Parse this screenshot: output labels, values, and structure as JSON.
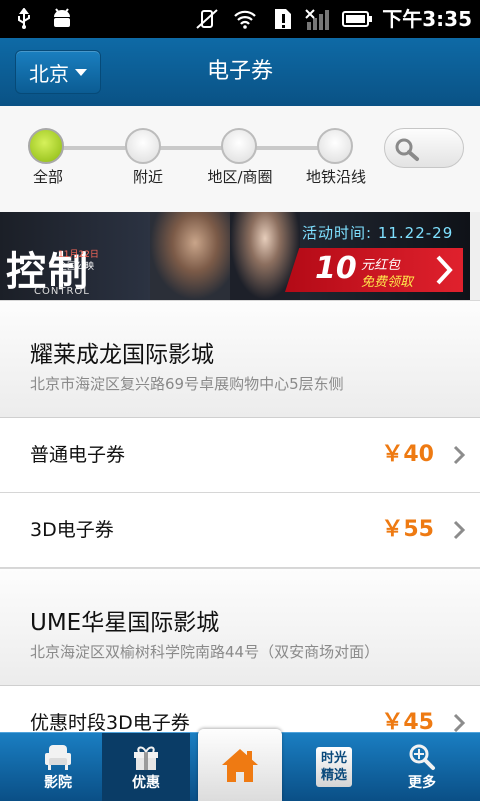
{
  "status_bar": {
    "time": "下午3:35"
  },
  "header": {
    "city": "北京",
    "title": "电子券"
  },
  "filters": [
    {
      "label": "全部",
      "active": true
    },
    {
      "label": "附近",
      "active": false
    },
    {
      "label": "地区/商圈",
      "active": false
    },
    {
      "label": "地铁沿线",
      "active": false
    }
  ],
  "banner": {
    "title": "控制",
    "release_date": "11月22日",
    "release_note": "全国公映",
    "english_title": "CONTROL",
    "activity_time": "活动时间: 11.22-29",
    "coupon_amount": "10",
    "coupon_line1": "元红包",
    "coupon_line2": "免费领取"
  },
  "cinemas": [
    {
      "name": "耀莱成龙国际影城",
      "address": "北京市海淀区复兴路69号卓展购物中心5层东侧",
      "vouchers": [
        {
          "name": "普通电子券",
          "price": "￥40"
        },
        {
          "name": "3D电子券",
          "price": "￥55"
        }
      ]
    },
    {
      "name": "UME华星国际影城",
      "address": "北京海淀区双榆树科学院南路44号（双安商场对面）",
      "vouchers": [
        {
          "name": "优惠时段3D电子券",
          "price": "￥45"
        }
      ]
    }
  ],
  "tabs": [
    {
      "label": "影院",
      "icon": "armchair-icon"
    },
    {
      "label": "优惠",
      "icon": "gift-icon",
      "selected": true
    },
    {
      "label": "",
      "icon": "home-icon"
    },
    {
      "label": "时光\n精选",
      "icon": "featured-badge"
    },
    {
      "label": "更多",
      "icon": "search-more-icon"
    }
  ],
  "colors": {
    "accent": "#0e6aa6",
    "price": "#ee7a12",
    "active_filter": "#8ab80f"
  }
}
